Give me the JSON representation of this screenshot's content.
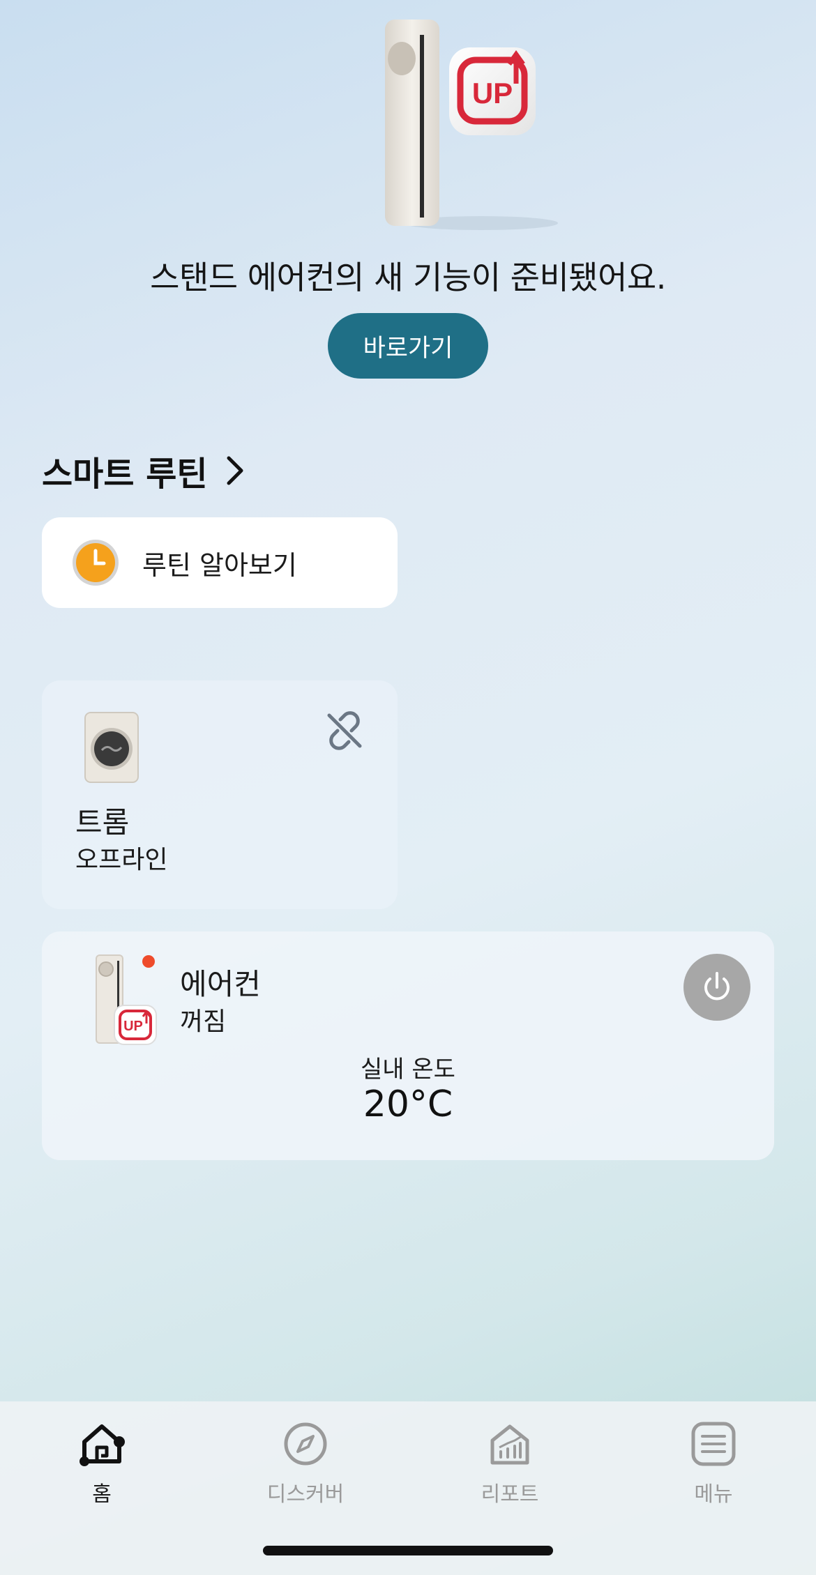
{
  "banner": {
    "text": "스탠드 에어컨의 새 기능이 준비됐어요.",
    "button_label": "바로가기",
    "badge_text": "UP"
  },
  "smart_routine": {
    "title": "스마트 루틴",
    "card_label": "루틴 알아보기"
  },
  "devices": {
    "dryer": {
      "name": "트롬",
      "status": "오프라인"
    },
    "aircon": {
      "name": "에어컨",
      "status": "꺼짐",
      "temp_label": "실내 온도",
      "temp_value": "20°C",
      "badge_text": "UP"
    }
  },
  "nav": {
    "items": [
      {
        "label": "홈",
        "icon": "home-icon",
        "active": true
      },
      {
        "label": "디스커버",
        "icon": "compass-icon",
        "active": false
      },
      {
        "label": "리포트",
        "icon": "report-icon",
        "active": false
      },
      {
        "label": "메뉴",
        "icon": "menu-icon",
        "active": false
      }
    ]
  },
  "colors": {
    "accent": "#1f6f86",
    "badge_red": "#d8283a",
    "notification_dot": "#ee4b2b",
    "clock_orange": "#f5a11c",
    "power_gray": "#a7a7a7"
  }
}
